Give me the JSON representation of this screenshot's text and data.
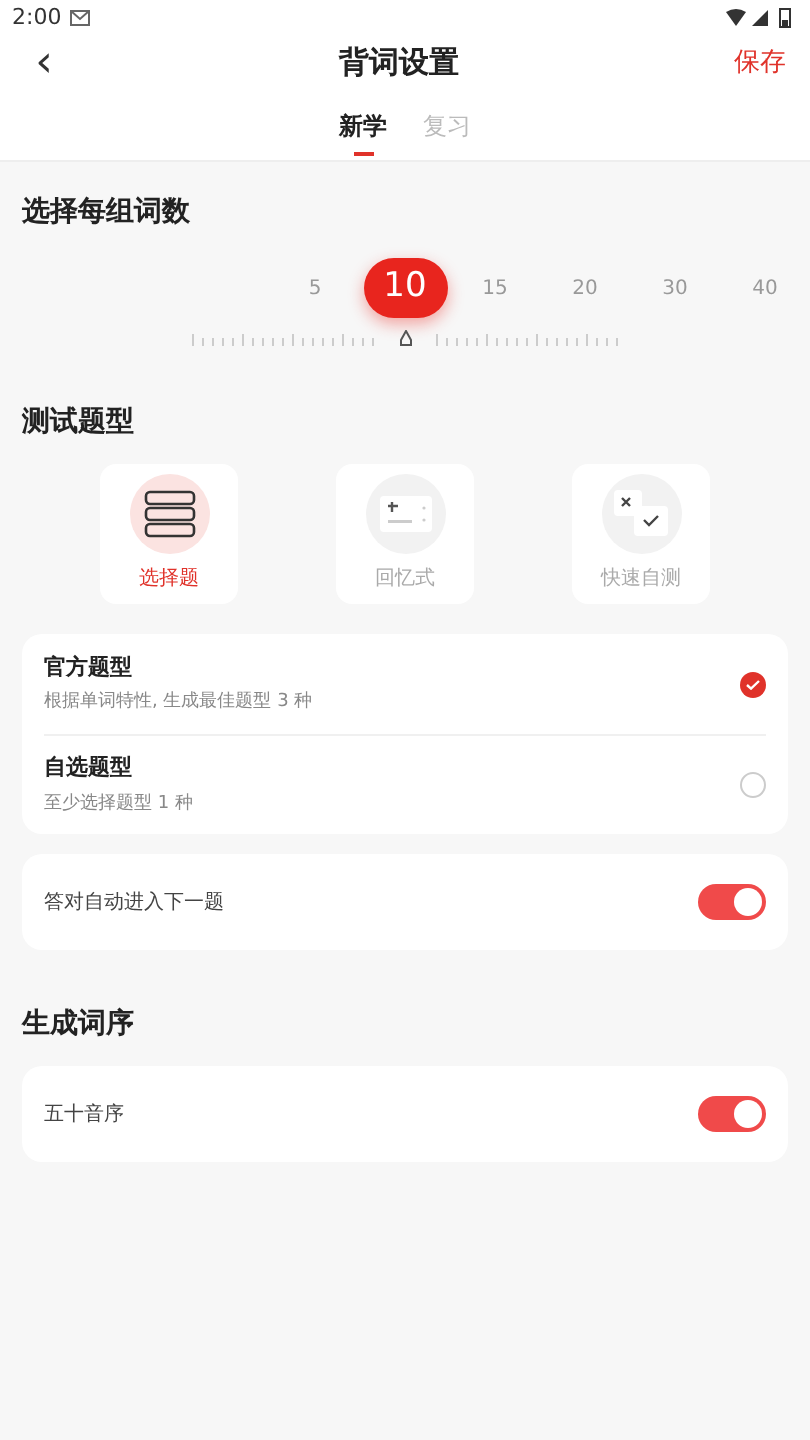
{
  "status_bar": {
    "time": "2:00"
  },
  "header": {
    "back": "‹",
    "title": "背词设置",
    "action": "保存"
  },
  "tabs": [
    {
      "label": "新学",
      "selected": true
    },
    {
      "label": "复习",
      "selected": false
    }
  ],
  "word_count": {
    "title": "选择每组词数",
    "options": [
      {
        "label": "5",
        "selected": false
      },
      {
        "label": "10",
        "selected": true
      },
      {
        "label": "15",
        "selected": false
      },
      {
        "label": "20",
        "selected": false
      },
      {
        "label": "30",
        "selected": false
      },
      {
        "label": "40",
        "selected": false
      }
    ]
  },
  "test_type": {
    "title": "测试题型",
    "modes": [
      {
        "label": "选择题",
        "kind": "choice",
        "selected": true
      },
      {
        "label": "回忆式",
        "kind": "recall",
        "selected": false
      },
      {
        "label": "快速自测",
        "kind": "quick",
        "selected": false
      }
    ],
    "options": [
      {
        "title": "官方题型",
        "subtitle": "根据单词特性, 生成最佳题型 3 种",
        "selected": true
      },
      {
        "title": "自选题型",
        "subtitle": "至少选择题型 1 种",
        "selected": false
      }
    ],
    "auto_next": {
      "label": "答对自动进入下一题",
      "on": true
    }
  },
  "order": {
    "title": "生成词序",
    "items": [
      {
        "label": "五十音序",
        "on": true
      }
    ]
  }
}
